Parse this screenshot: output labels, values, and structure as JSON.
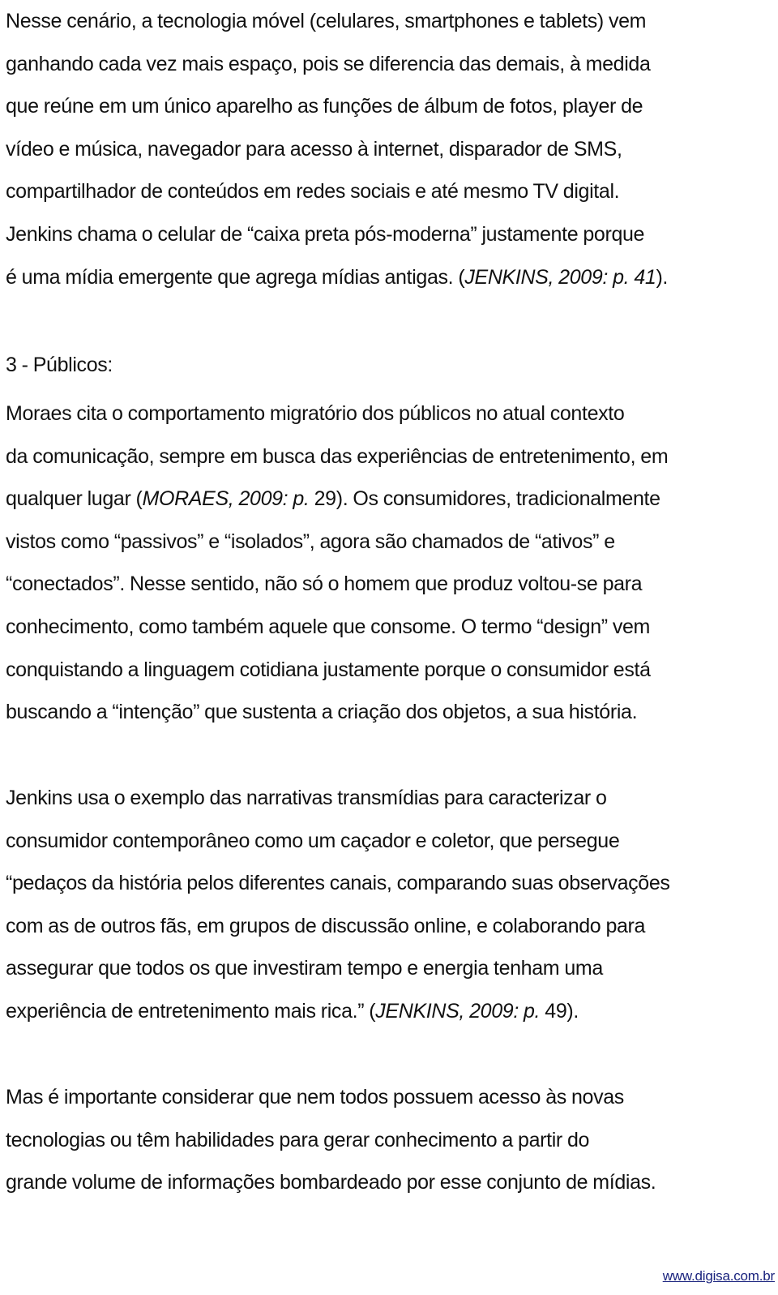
{
  "document": {
    "paragraph_1": {
      "lines": [
        "Nesse cenário, a tecnologia móvel (celulares, smartphones e tablets) vem",
        "ganhando cada vez mais espaço, pois se diferencia das demais, à medida",
        "que reúne em um único aparelho as funções de álbum de fotos, player de",
        "vídeo e música, navegador para acesso à internet, disparador de SMS,",
        "compartilhador de conteúdos em redes sociais e até mesmo TV digital.",
        "Jenkins chama o celular de “caixa preta pós-moderna” justamente porque"
      ],
      "last_line_text": "é uma mídia emergente que agrega mídias antigas. (",
      "last_line_citation": "JENKINS, 2009: p. 41",
      "last_line_end": ")."
    },
    "section_heading": "3 - Públicos:",
    "paragraph_2": {
      "line_1": "Moraes cita o comportamento migratório dos públicos no atual contexto",
      "line_2": "da comunicação, sempre em busca das experiências de entretenimento, em",
      "line_3_start": "qualquer lugar (",
      "line_3_citation": "MORAES, 2009: p.",
      "line_3_end": " 29). Os consumidores, tradicionalmente",
      "lines_rest": [
        "vistos como “passivos” e “isolados”, agora são chamados de “ativos” e",
        "“conectados”. Nesse sentido, não só o homem que produz voltou-se para",
        "conhecimento, como também aquele que consome. O termo “design” vem",
        "conquistando a linguagem cotidiana justamente porque o consumidor está",
        "buscando a “intenção” que sustenta a criação dos objetos, a sua história."
      ]
    },
    "paragraph_3": {
      "lines": [
        "Jenkins usa o exemplo das narrativas transmídias para caracterizar o",
        "consumidor contemporâneo como um caçador e coletor, que persegue",
        "“pedaços da história pelos diferentes canais, comparando suas observações",
        "com as de outros fãs, em grupos de discussão online, e colaborando para",
        "assegurar que todos os que investiram tempo e energia tenham uma"
      ],
      "last_line_text": "experiência de entretenimento mais rica.” (",
      "last_line_citation": "JENKINS, 2009: p.",
      "last_line_end": " 49)."
    },
    "paragraph_4": {
      "lines": [
        "Mas é importante considerar que nem todos possuem acesso às novas",
        "tecnologias ou têm habilidades para gerar conhecimento a partir do",
        "grande volume de informações bombardeado por esse conjunto de mídias."
      ]
    },
    "footer": {
      "link_text": "www.digisa.com.br",
      "link_color": "#1a237e"
    }
  }
}
